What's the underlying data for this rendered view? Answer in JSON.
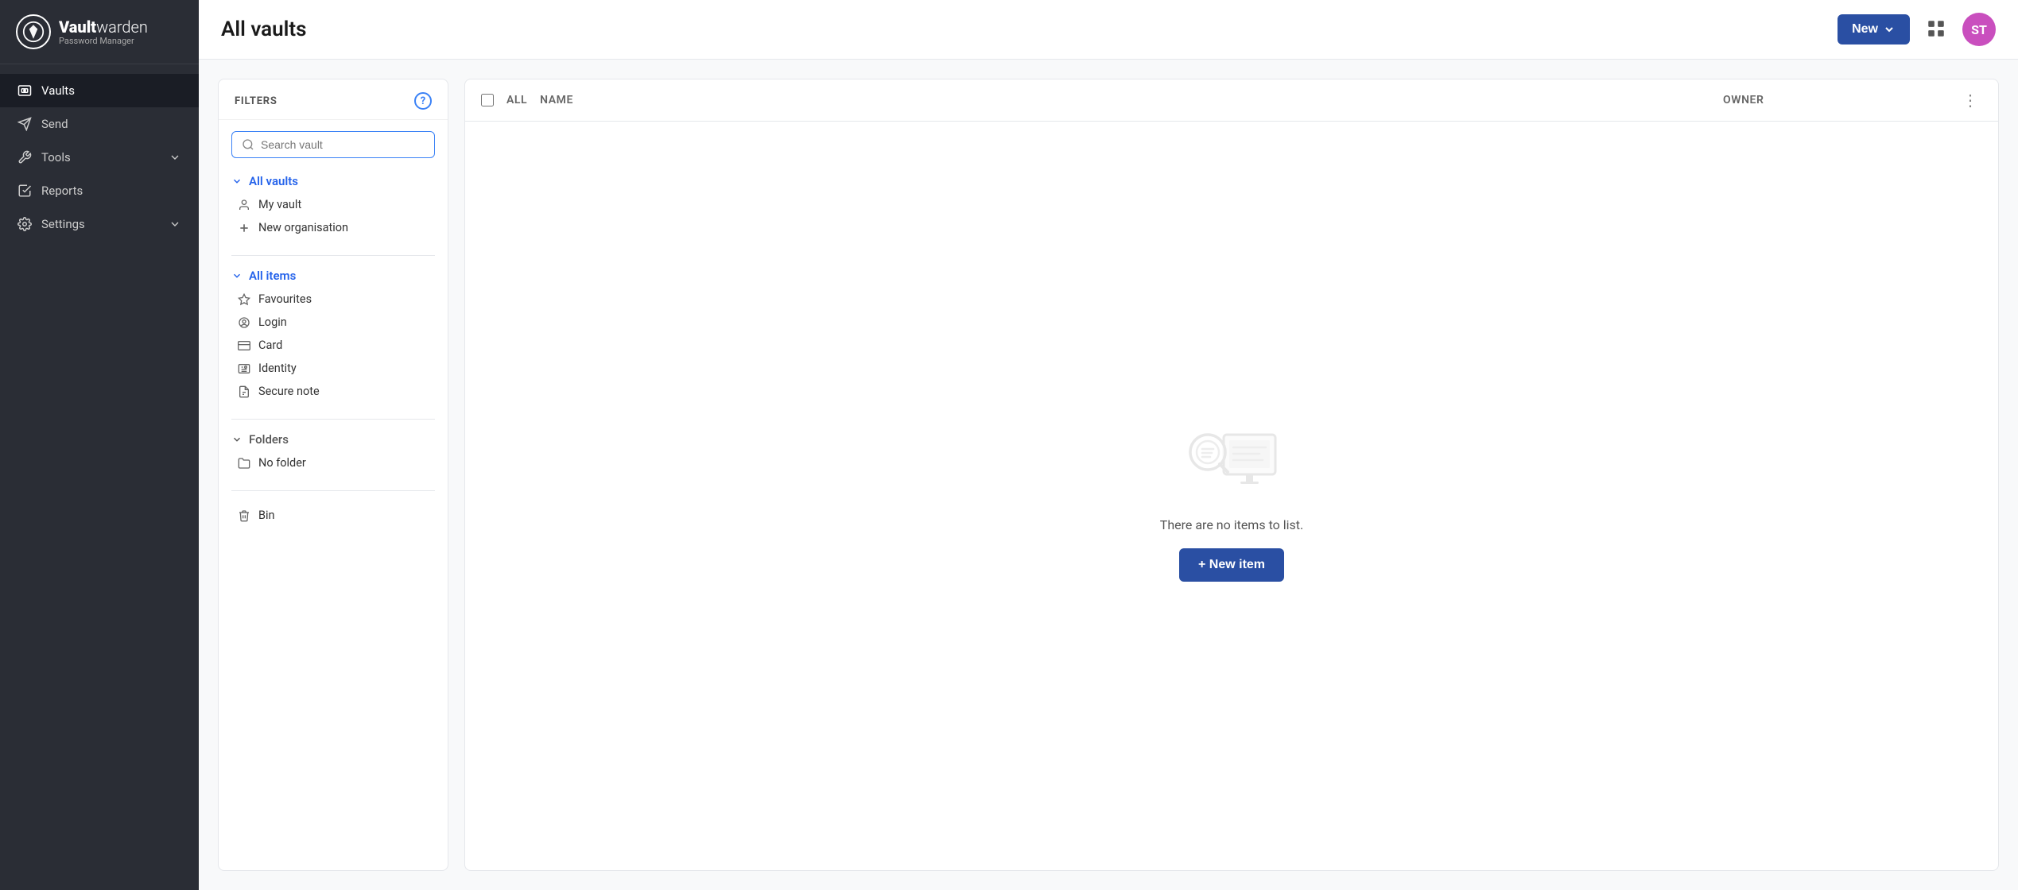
{
  "app": {
    "name": "Vaultwarden",
    "subtitle": "Password Manager",
    "page_title": "All vaults"
  },
  "header": {
    "new_button": "New",
    "avatar_initials": "ST"
  },
  "sidebar": {
    "items": [
      {
        "id": "vaults",
        "label": "Vaults",
        "icon": "vault-icon",
        "active": true
      },
      {
        "id": "send",
        "label": "Send",
        "icon": "send-icon",
        "active": false
      },
      {
        "id": "tools",
        "label": "Tools",
        "icon": "tools-icon",
        "active": false,
        "has_chevron": true
      },
      {
        "id": "reports",
        "label": "Reports",
        "icon": "reports-icon",
        "active": false
      },
      {
        "id": "settings",
        "label": "Settings",
        "icon": "settings-icon",
        "active": false,
        "has_chevron": true
      }
    ]
  },
  "filters": {
    "title": "FILTERS",
    "help_title": "?",
    "search_placeholder": "Search vault",
    "vaults_section": {
      "title": "All vaults",
      "items": [
        {
          "label": "My vault",
          "icon": "person-icon"
        },
        {
          "label": "New organisation",
          "icon": "plus-icon"
        }
      ]
    },
    "items_section": {
      "title": "All items",
      "items": [
        {
          "label": "Favourites",
          "icon": "star-icon"
        },
        {
          "label": "Login",
          "icon": "login-icon"
        },
        {
          "label": "Card",
          "icon": "card-icon"
        },
        {
          "label": "Identity",
          "icon": "identity-icon"
        },
        {
          "label": "Secure note",
          "icon": "note-icon"
        }
      ]
    },
    "folders_section": {
      "title": "Folders",
      "items": [
        {
          "label": "No folder",
          "icon": "folder-icon"
        }
      ]
    },
    "bin": {
      "label": "Bin",
      "icon": "bin-icon"
    }
  },
  "table": {
    "columns": [
      {
        "id": "name",
        "label": "Name"
      },
      {
        "id": "owner",
        "label": "Owner"
      }
    ],
    "select_all_label": "All"
  },
  "empty_state": {
    "message": "There are no items to list.",
    "new_item_button": "+ New item"
  }
}
